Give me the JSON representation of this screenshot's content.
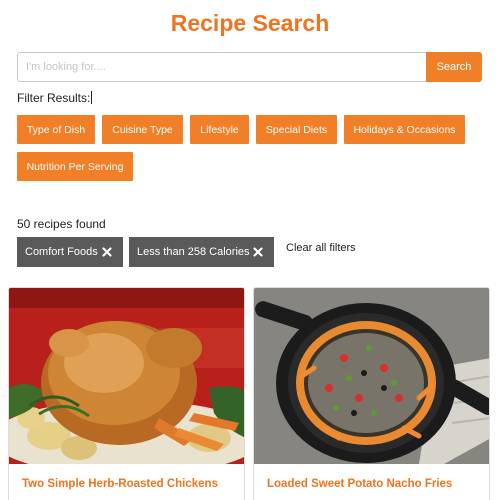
{
  "page": {
    "title": "Recipe Search"
  },
  "search": {
    "placeholder": "I'm looking for....",
    "button_label": "Search"
  },
  "filters": {
    "label": "Filter Results:",
    "buttons": [
      {
        "label": "Type of Dish"
      },
      {
        "label": "Cuisine Type"
      },
      {
        "label": "Lifestyle"
      },
      {
        "label": "Special Diets"
      },
      {
        "label": "Holidays & Occasions"
      },
      {
        "label": "Nutrition Per Serving"
      }
    ]
  },
  "results": {
    "count_text": "50 recipes found",
    "active_filters": [
      {
        "label": "Comfort Foods"
      },
      {
        "label": "Less than 258 Calories"
      }
    ],
    "clear_label": "Clear all filters"
  },
  "recipes": [
    {
      "title": "Two Simple Herb-Roasted Chickens"
    },
    {
      "title": "Loaded Sweet Potato Nacho Fries"
    }
  ],
  "colors": {
    "accent": "#f07f27",
    "title": "#f0731f",
    "chip": "#5a5a5a"
  }
}
